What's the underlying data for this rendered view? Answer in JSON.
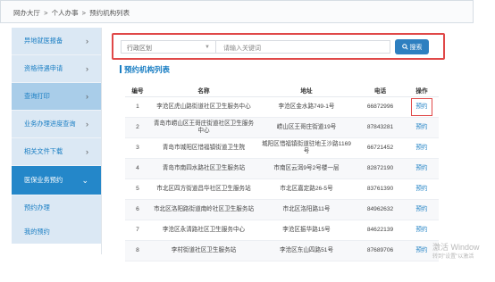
{
  "breadcrumb": [
    "网办大厅",
    ">",
    "个人办事",
    ">",
    "预约机构列表"
  ],
  "sidebar": {
    "items": [
      {
        "label": "异地就医报备",
        "chevron": "›"
      },
      {
        "label": "资格待遇申请",
        "chevron": "›"
      },
      {
        "label": "查询打印",
        "chevron": "›"
      },
      {
        "label": "业务办理进度查询",
        "chevron": "›"
      },
      {
        "label": "相关文件下载",
        "chevron": "›"
      },
      {
        "label": "医保业务预约",
        "chevron": "⌄"
      }
    ],
    "subitems": [
      "预约办理",
      "我的预约"
    ]
  },
  "search": {
    "region_placeholder": "行政区划",
    "keyword_placeholder": "请输入关键词",
    "button_label": "搜索"
  },
  "list_title": "预约机构列表",
  "table": {
    "headers": [
      "编号",
      "名称",
      "地址",
      "电话",
      "操作"
    ],
    "rows": [
      {
        "no": "1",
        "name": "李沧区虎山路街道社区卫生服务中心",
        "address": "李沧区金水路749-1号",
        "phone": "66872996",
        "op": "预约"
      },
      {
        "no": "2",
        "name": "青岛市崂山区王哥庄街道社区卫生服务中心",
        "address": "崂山区王哥庄街道19号",
        "phone": "87843281",
        "op": "预约"
      },
      {
        "no": "3",
        "name": "青岛市城阳区惜福镇街道卫生院",
        "address": "城阳区惜福镇街道驻地王沙路1169号",
        "phone": "66721452",
        "op": "预约"
      },
      {
        "no": "4",
        "name": "青岛市南四水路社区卫生服务站",
        "address": "市南区云洱9号2号楼一层",
        "phone": "82872190",
        "op": "预约"
      },
      {
        "no": "5",
        "name": "市北区四方街道昌华社区卫生服务站",
        "address": "市北区嘉定路26-5号",
        "phone": "83761390",
        "op": "预约"
      },
      {
        "no": "6",
        "name": "市北区洛阳路街道南岭社区卫生服务站",
        "address": "市北区洛阳路11号",
        "phone": "84962632",
        "op": "预约"
      },
      {
        "no": "7",
        "name": "李沧区永清路社区卫生服务中心",
        "address": "李沧区振华路15号",
        "phone": "84622139",
        "op": "预约"
      },
      {
        "no": "8",
        "name": "李村街道社区卫生服务站",
        "address": "李沧区东山四路51号",
        "phone": "87689706",
        "op": "预约"
      }
    ]
  },
  "watermark": {
    "line1": "激活 Window",
    "line2": "转到\"设置\"以激活"
  },
  "colors": {
    "accent": "#2487c9",
    "highlight_border": "#e04848",
    "sidebar_bg": "#dbe8f4"
  }
}
